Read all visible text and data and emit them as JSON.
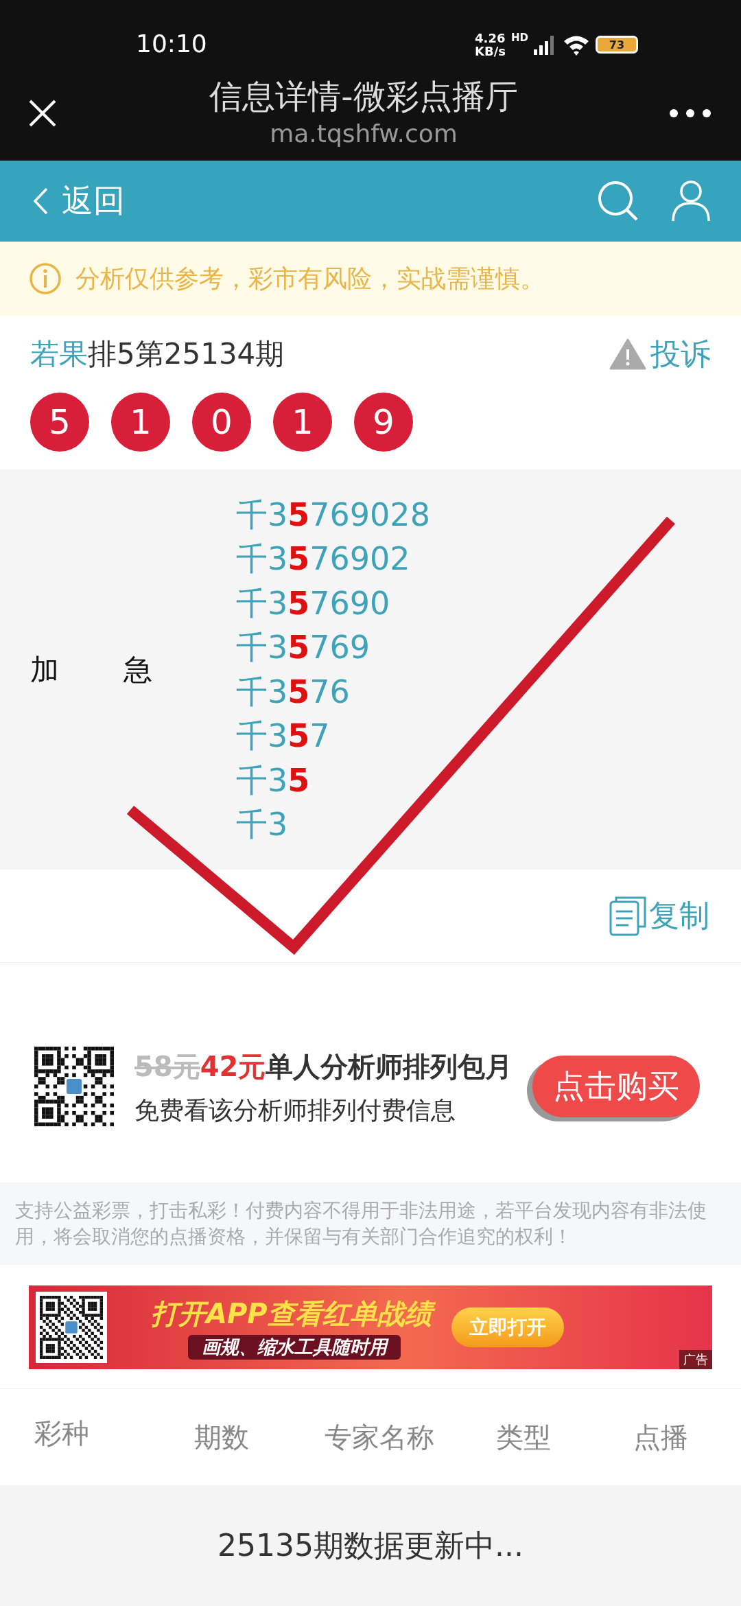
{
  "status_bar": {
    "time": "10:10",
    "net_speed": "4.26",
    "net_unit": "KB/s",
    "network_badge": "HD",
    "battery": "73"
  },
  "browser_bar": {
    "title": "信息详情-微彩点播厅",
    "url": "ma.tqshfw.com"
  },
  "nav": {
    "back_label": "返回"
  },
  "notice": {
    "text": "分析仅供参考，彩市有风险，实战需谨慎。"
  },
  "issue": {
    "analyst": "若果",
    "title": "排5第25134期",
    "complaint_label": "投诉"
  },
  "balls": [
    "5",
    "1",
    "0",
    "1",
    "9"
  ],
  "recommendation": {
    "label_parts": [
      "加",
      "急"
    ],
    "lines": [
      "千3**5**769028",
      "千3**5**76902",
      "千3**5**7690",
      "千3**5**769",
      "千3**5**76",
      "千3**5**7",
      "千3**5**",
      "千3"
    ]
  },
  "copy_label": "复制",
  "product": {
    "old_price": "58元",
    "new_price": "42元",
    "name": "单人分析师排列包月",
    "subtitle": "免费看该分析师排列付费信息",
    "buy_label": "点击购买"
  },
  "disclaimer": "支持公益彩票，打击私彩！付费内容不得用于非法用途，若平台发现内容有非法使用，将会取消您的点播资格，并保留与有关部门合作追究的权利！",
  "banner": {
    "headline": "打开APP查看红单战绩",
    "subline": "画规、缩水工具随时用",
    "button": "立即打开",
    "tag": "广告"
  },
  "table": {
    "columns": [
      "彩种",
      "期数",
      "专家名称",
      "类型",
      "点播"
    ]
  },
  "loading_text": "25135期数据更新中..."
}
